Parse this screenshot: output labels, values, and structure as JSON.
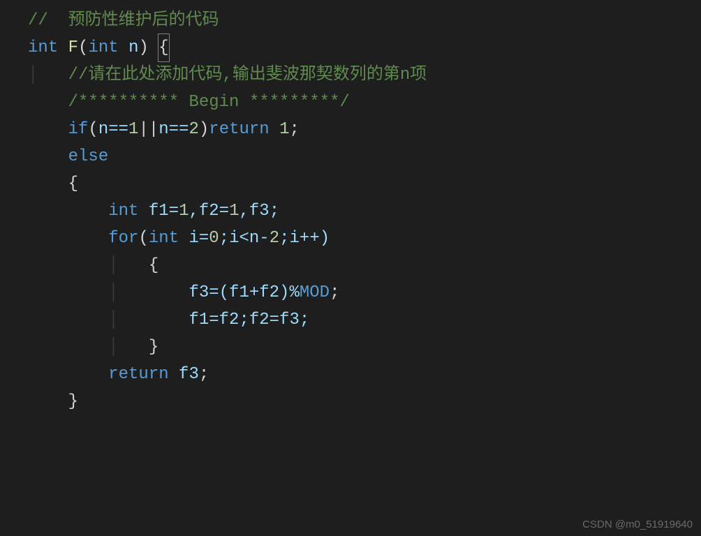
{
  "code": {
    "comment1": "//  预防性维护后的代码",
    "kw_int": "int",
    "func_name": "F",
    "param_n": "n",
    "brace_open": "{",
    "comment2": "//请在此处添加代码,输出斐波那契数列的第n项",
    "comment3": "/********** Begin *********/",
    "kw_if": "if",
    "cond_open": "(",
    "eq1": "n==",
    "num1": "1",
    "or": "||",
    "eq2": "n==",
    "num2": "2",
    "cond_close": ")",
    "kw_return": "return",
    "ret1": "1",
    "semi": ";",
    "kw_else": "else",
    "brace2": "{",
    "decl": "f1=",
    "d1": "1",
    "comma1": ",f2=",
    "d2": "1",
    "comma2": ",f3;",
    "kw_for": "for",
    "for_open": "(",
    "idecl": "i=",
    "z0": "0",
    "fsemi1": ";i<n-",
    "z2": "2",
    "fsemi2": ";i++)",
    "brace3": "{",
    "body1a": "f3=(f1+f2)%",
    "mod": "MOD",
    "body1b": ";",
    "body2": "f1=f2;f2=f3;",
    "brace3c": "}",
    "kw_return2": "return",
    "retvar": "f3",
    "semi2": ";",
    "brace2c": "}"
  },
  "watermark": "CSDN @m0_51919640"
}
